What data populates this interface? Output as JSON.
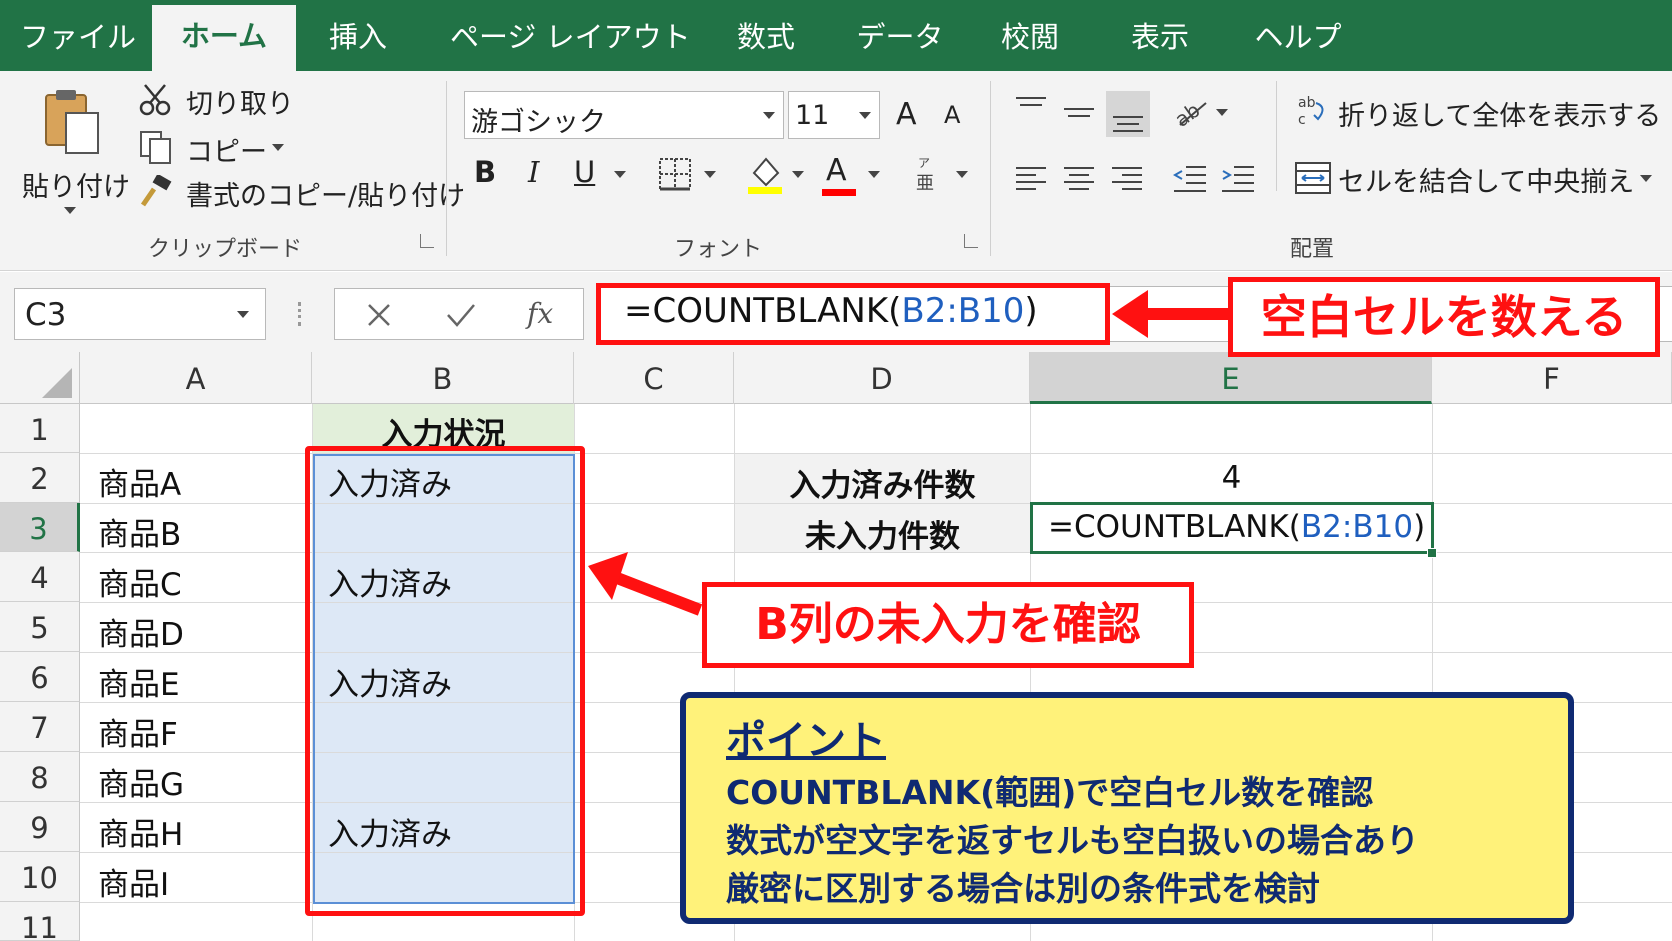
{
  "tabs": [
    "ファイル",
    "ホーム",
    "挿入",
    "ページ レイアウト",
    "数式",
    "データ",
    "校閲",
    "表示",
    "ヘルプ"
  ],
  "active_tab": "ホーム",
  "ribbon": {
    "clipboard": {
      "paste": "貼り付け",
      "cut": "切り取り",
      "copy": "コピー",
      "format_painter": "書式のコピー/貼り付け",
      "group_label": "クリップボード"
    },
    "font": {
      "font_name": "游ゴシック",
      "font_size": "11",
      "bold": "B",
      "italic": "I",
      "underline": "U",
      "font_color_letter": "A",
      "grow_letter": "A",
      "shrink_letter": "A",
      "group_label": "フォント",
      "fill_color": "#ffff00",
      "font_color": "#ff0000"
    },
    "alignment": {
      "wrap_text": "折り返して全体を表示する",
      "merge_center": "セルを結合して中央揃え",
      "group_label": "配置"
    }
  },
  "formula_bar": {
    "name_box": "C3",
    "fx": "fx",
    "formula_prefix": "=COUNTBLANK(",
    "formula_range": "B2:B10",
    "formula_suffix": ")"
  },
  "columns": [
    "A",
    "B",
    "C",
    "D",
    "E",
    "F"
  ],
  "rows": [
    "1",
    "2",
    "3",
    "4",
    "5",
    "6",
    "7",
    "8",
    "9",
    "10",
    "11"
  ],
  "selected_column": "E",
  "selected_row": "3",
  "sheet": {
    "b1_header": "入力状況",
    "col_a": [
      "",
      "商品A",
      "商品B",
      "商品C",
      "商品D",
      "商品E",
      "商品F",
      "商品G",
      "商品H",
      "商品I"
    ],
    "col_b": [
      "",
      "入力済み",
      "",
      "入力済み",
      "",
      "入力済み",
      "",
      "",
      "入力済み",
      ""
    ],
    "d2_label": "入力済み件数",
    "e2_value": "4",
    "d3_label": "未入力件数",
    "e3_prefix": "=COUNTBLANK(",
    "e3_range": "B2:B10",
    "e3_suffix": ")"
  },
  "callouts": {
    "count_blank": "空白セルを数える",
    "check_column": "B列の未入力を確認"
  },
  "point_box": {
    "title": "ポイント",
    "lines": [
      "COUNTBLANK(範囲)で空白セル数を確認",
      "数式が空文字を返すセルも空白扱いの場合あり",
      "厳密に区別する場合は別の条件式を検討"
    ]
  },
  "colors": {
    "excel_green": "#217346",
    "annotation_red": "#ff1111",
    "range_blue": "#1f5fbf",
    "header_fill": "#e2efda",
    "selection_fill": "#dde8f6",
    "point_fill": "#fff27a",
    "point_border": "#0f2a72",
    "point_text": "#0f2a72"
  }
}
